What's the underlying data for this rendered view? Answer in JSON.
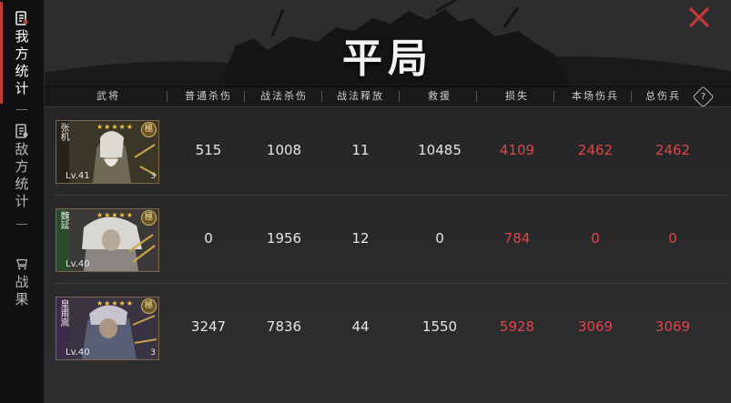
{
  "sidebar": {
    "items": [
      {
        "label": "我方统计",
        "icon": "scroll-icon",
        "active": true
      },
      {
        "label": "敌方统计",
        "icon": "scroll-icon",
        "active": false
      },
      {
        "label": "战果",
        "icon": "cart-icon",
        "active": false
      }
    ]
  },
  "title": "平局",
  "columns": [
    "武将",
    "普通杀伤",
    "战法杀伤",
    "战法释放",
    "救援",
    "损失",
    "本场伤兵",
    "总伤兵"
  ],
  "help_label": "?",
  "rows": [
    {
      "name": "张机",
      "level": "Lv.41",
      "stars": "★★★★★",
      "badge": "極",
      "count": "3",
      "normal_kill": "515",
      "skill_kill": "1008",
      "skill_cast": "11",
      "rescue": "10485",
      "loss": "4109",
      "wounded_battle": "2462",
      "wounded_total": "2462"
    },
    {
      "name": "魏延",
      "level": "Lv.40",
      "stars": "★★★★★",
      "badge": "極",
      "count": "",
      "normal_kill": "0",
      "skill_kill": "1956",
      "skill_cast": "12",
      "rescue": "0",
      "loss": "784",
      "wounded_battle": "0",
      "wounded_total": "0"
    },
    {
      "name": "皇甫嵩",
      "level": "Lv.40",
      "stars": "★★★★★",
      "badge": "極",
      "count": "3",
      "normal_kill": "3247",
      "skill_kill": "7836",
      "skill_cast": "44",
      "rescue": "1550",
      "loss": "5928",
      "wounded_battle": "3069",
      "wounded_total": "3069"
    }
  ],
  "colors": {
    "accent": "#c13a34",
    "loss_red": "#e0454a",
    "gold": "#f4c542"
  }
}
